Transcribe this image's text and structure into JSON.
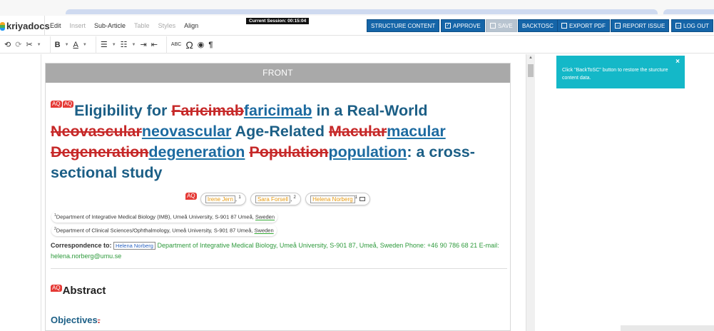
{
  "app": {
    "logo": "kriyadocs",
    "session": "Current Session: 00:15:04"
  },
  "menu": [
    {
      "label": "Edit",
      "enabled": true
    },
    {
      "label": "Insert",
      "enabled": false
    },
    {
      "label": "Sub-Article",
      "enabled": true
    },
    {
      "label": "Table",
      "enabled": false
    },
    {
      "label": "Styles",
      "enabled": false
    },
    {
      "label": "Align",
      "enabled": true
    }
  ],
  "actions": {
    "structure": "STRUCTURE CONTENT",
    "approve": "APPROVE",
    "save": "SAVE",
    "backtosc": "BACKTOSC",
    "export": "EXPORT PDF",
    "report": "REPORT ISSUE",
    "logout": "LOG OUT"
  },
  "toolbar": {
    "undo": "⟲",
    "redo": "⟳",
    "cut": "✂",
    "bold": "B",
    "underline_a": "A",
    "bullets": "☰",
    "numbered": "☷",
    "indent": "⇥",
    "outdent": "⇤",
    "spell": "ABC",
    "omega": "Ω",
    "eye": "◉",
    "pilcrow": "¶"
  },
  "document": {
    "front_label": "FRONT",
    "aq": "AQ",
    "title": {
      "t1": "Eligibility for ",
      "del1": "Faricimab",
      "ins1": "faricimab",
      "t2": " in a Real-World ",
      "del2": "Neovascular",
      "ins2": "neovascular",
      "t3": " Age-Related ",
      "del3": "Macular",
      "ins3": "macular",
      "del4": "Degeneration",
      "ins4": "degeneration",
      "t4": " ",
      "del5": "Population",
      "ins5": "population",
      "t5": ": a cross-sectional study"
    },
    "authors": [
      {
        "name": "Irene Jern",
        "sup": "1"
      },
      {
        "name": "Sara Forsell",
        "sup": "2"
      },
      {
        "name": "Helena Norberg",
        "sup": "1"
      }
    ],
    "affiliations": [
      {
        "sup": "1",
        "text": "Department of Integrative Medical Biology (IMB), Umeå University, S-901 87 Umeå, ",
        "country": "Sweden"
      },
      {
        "sup": "2",
        "text": "Department of Clinical Sciences/Ophthalmology, Umeå University, S-901 87 Umeå, ",
        "country": "Sweden"
      }
    ],
    "correspondence": {
      "label": "Correspondence to:",
      "name": "Helena Norberg",
      "text": " Department of Integrative Medical Biology, Umeå University, S-901 87, Umeå, Sweden Phone: +46 90 786 68 21 E-mail: helena.norberg@umu.se"
    },
    "abstract": "Abstract",
    "objectives": "Objectives",
    "objectives_del": "."
  },
  "toast": {
    "message": "Click \"BackToSC\" button to restore the sturcture content data.",
    "close": "×"
  }
}
